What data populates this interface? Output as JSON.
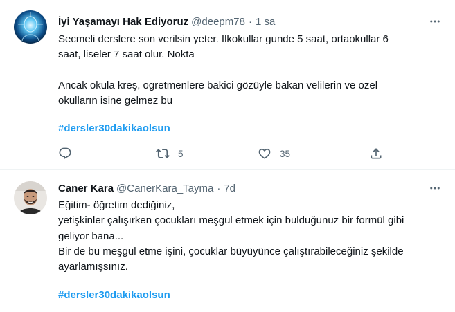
{
  "tweets": [
    {
      "display_name": "İyi Yaşamayı Hak Ediyoruz",
      "handle": "@deepm78",
      "separator": "·",
      "time": "1 sa",
      "text": "Secmeli derslere son verilsin yeter. Ilkokullar gunde 5 saat, ortaokullar 6\nsaat, liseler 7 saat olur. Nokta\n\nAncak okula kreş, ogretmenlere bakici gözüyle bakan velilerin ve ozel\nokulların isine gelmez bu",
      "hashtag": "#dersler30dakikaolsun",
      "retweets": "5",
      "likes": "35",
      "avatar_icon": "blue-glowing-head-avatar"
    },
    {
      "display_name": "Caner Kara",
      "handle": "@CanerKara_Tayma",
      "separator": "·",
      "time": "7d",
      "text": "Eğitim- öğretim dediğiniz,\nyetişkinler çalışırken çocukları meşgul etmek için bulduğunuz bir formül gibi\ngeliyor bana...\nBir de bu meşgul etme işini, çocuklar büyüyünce çalıştırabileceğiniz şekilde\nayarlamışsınız.",
      "hashtag": "#dersler30dakikaolsun",
      "avatar_icon": "man-with-beard-avatar"
    }
  ],
  "icons": {
    "more": "more-horizontal-icon",
    "reply": "reply-icon",
    "retweet": "retweet-icon",
    "like": "heart-icon",
    "share": "share-icon"
  },
  "colors": {
    "text": "#0f1419",
    "secondary": "#536471",
    "link": "#1d9bf0",
    "divider": "#eff3f4"
  }
}
